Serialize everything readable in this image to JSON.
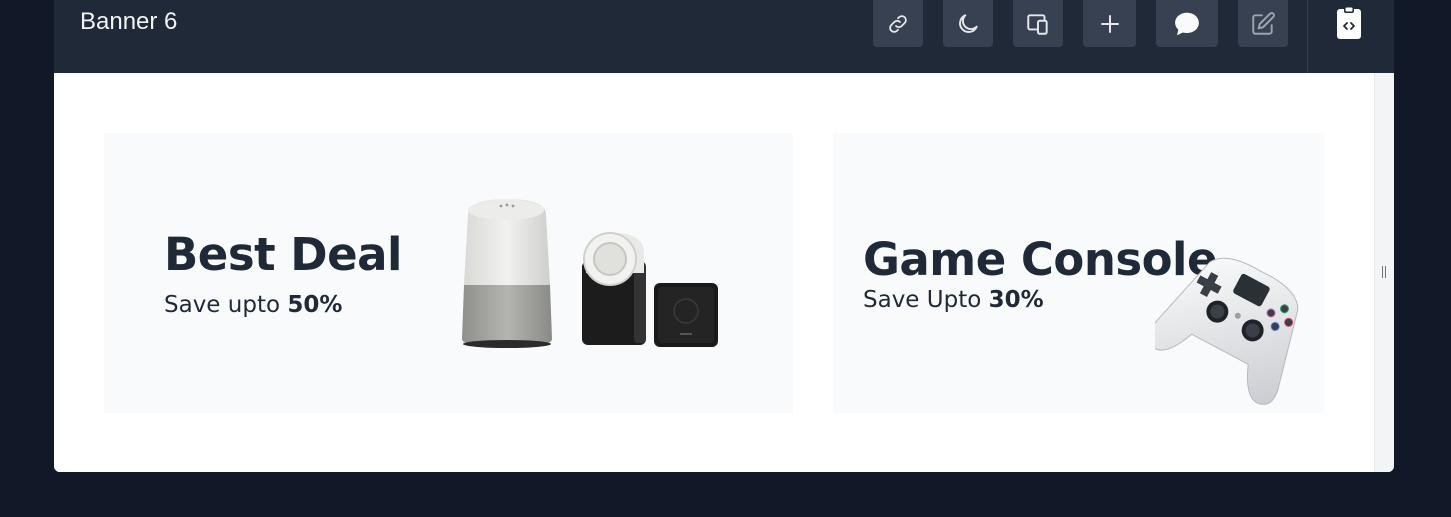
{
  "window": {
    "title": "Banner 6"
  },
  "toolbar": {
    "icons": [
      "link-icon",
      "moon-icon",
      "devices-icon",
      "plus-icon",
      "chat-bubble-icon",
      "edit-icon",
      "clipboard-code-icon"
    ]
  },
  "banners": [
    {
      "heading": "Best Deal",
      "subtitle_prefix": "Save upto",
      "subtitle_value": "50%"
    },
    {
      "heading": "Game Console",
      "subtitle_prefix": "Save Upto",
      "subtitle_value": "30%"
    }
  ],
  "colors": {
    "page_background": "#111827",
    "topbar": "#1f2937",
    "button": "#374151",
    "card": "#f9fafb",
    "text": "#1f2937"
  }
}
